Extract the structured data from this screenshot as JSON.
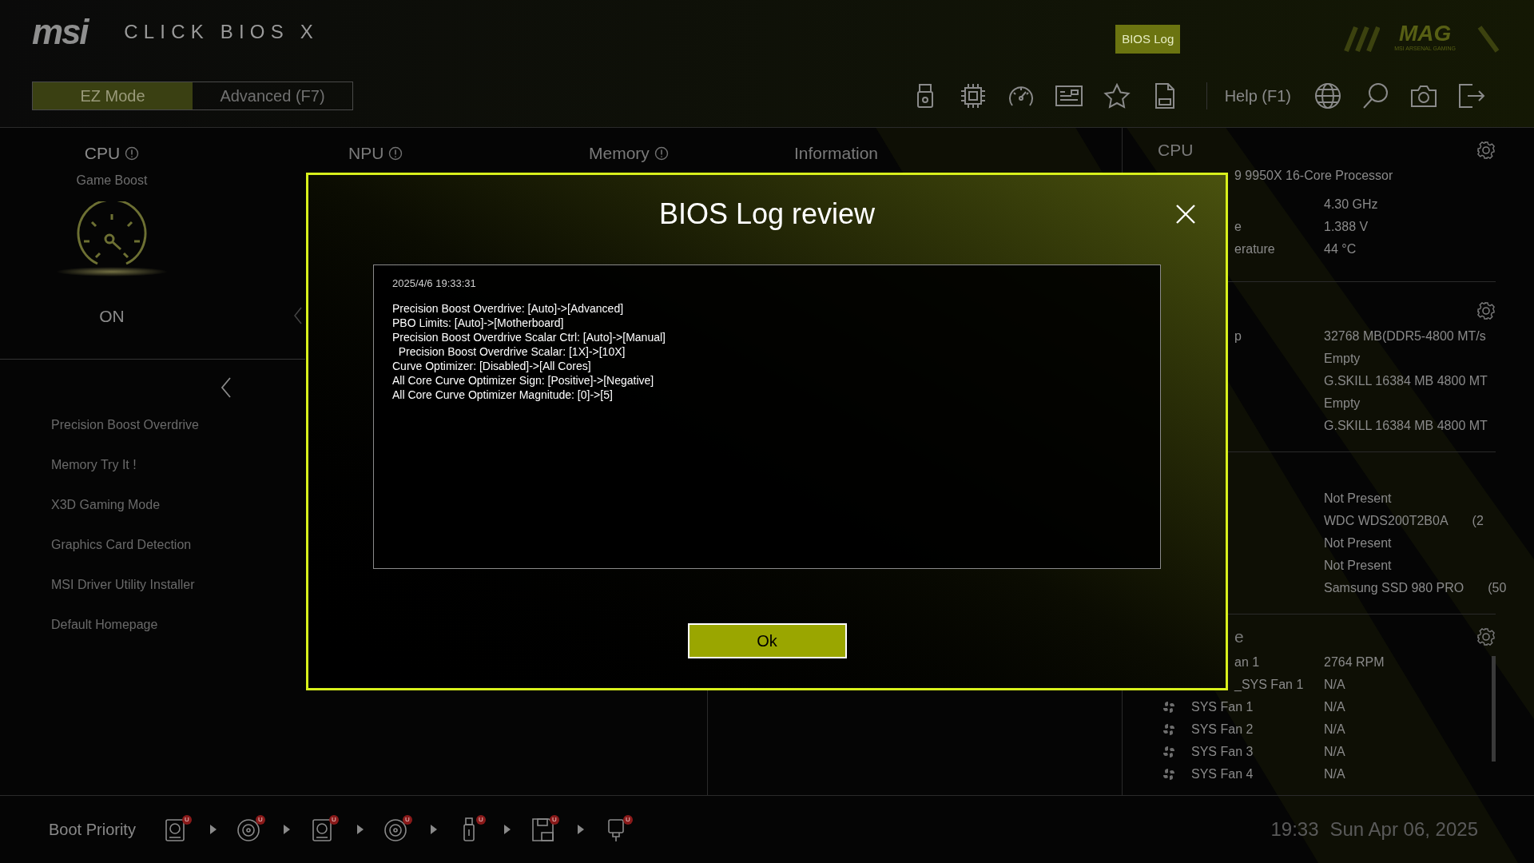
{
  "header": {
    "brand": "msi",
    "product": "CLICK BIOS X",
    "bios_log_tag": "BIOS Log",
    "gaming_logo": {
      "title": "MAG",
      "subtitle": "MSI ARSENAL GAMING"
    },
    "modes": [
      {
        "label": "EZ Mode",
        "selected": true
      },
      {
        "label": "Advanced (F7)",
        "selected": false
      }
    ],
    "help": "Help (F1)"
  },
  "game_boost": {
    "title": "CPU",
    "subtitle": "Game Boost",
    "state": "ON"
  },
  "columns": [
    {
      "title": "NPU",
      "info": true
    },
    {
      "title": "Memory",
      "info": true
    },
    {
      "title": "Information",
      "info": false
    }
  ],
  "menu": [
    "Precision Boost Overdrive",
    "Memory Try It !",
    "X3D Gaming Mode",
    "Graphics Card Detection",
    "MSI Driver Utility Installer",
    "Default Homepage"
  ],
  "right_panel": {
    "cpu": {
      "title": "CPU",
      "processor": "9 9950X 16-Core Processor",
      "rows": [
        {
          "label": "",
          "value": "4.30 GHz"
        },
        {
          "label": "e",
          "value": "1.388 V"
        },
        {
          "label": "erature",
          "value": "44 °C"
        }
      ]
    },
    "memory": {
      "rows": [
        {
          "label": "p",
          "value": "32768 MB(DDR5-4800 MT/s"
        },
        {
          "label": "",
          "value": "Empty"
        },
        {
          "label": "",
          "value": "G.SKILL 16384 MB 4800 MT"
        },
        {
          "label": "",
          "value": "Empty"
        },
        {
          "label": "",
          "value": "G.SKILL 16384 MB 4800 MT"
        }
      ]
    },
    "storage": {
      "rows": [
        {
          "value": "Not Present",
          "size": ""
        },
        {
          "value": "WDC WDS200T2B0A",
          "size": "(2"
        },
        {
          "value": "Not Present",
          "size": ""
        },
        {
          "value": "Not Present",
          "size": ""
        },
        {
          "value": "Samsung SSD 980 PRO",
          "size": "(50"
        }
      ]
    },
    "fans": {
      "title": "e",
      "rows": [
        {
          "label": "an 1",
          "value": "2764 RPM",
          "occluded": true
        },
        {
          "label": "_SYS Fan 1",
          "value": "N/A",
          "occluded": true
        },
        {
          "label": "SYS Fan 1",
          "value": "N/A",
          "occluded": false
        },
        {
          "label": "SYS Fan 2",
          "value": "N/A",
          "occluded": false
        },
        {
          "label": "SYS Fan 3",
          "value": "N/A",
          "occluded": false
        },
        {
          "label": "SYS Fan 4",
          "value": "N/A",
          "occluded": false
        }
      ]
    }
  },
  "boot_priority": {
    "label": "Boot Priority",
    "devices": [
      {
        "kind": "hdd",
        "badge": "U"
      },
      {
        "kind": "disc",
        "badge": "U"
      },
      {
        "kind": "hdd",
        "badge": "U"
      },
      {
        "kind": "disc",
        "badge": "U"
      },
      {
        "kind": "usb",
        "badge": "U"
      },
      {
        "kind": "floppy",
        "badge": "U"
      },
      {
        "kind": "plug",
        "badge": "U"
      }
    ]
  },
  "clock": {
    "time": "19:33",
    "date": "Sun Apr 06, 2025"
  },
  "dialog": {
    "title": "BIOS Log review",
    "timestamp": "2025/4/6 19:33:31",
    "lines": [
      "Precision Boost Overdrive: [Auto]->[Advanced]",
      "PBO Limits: [Auto]->[Motherboard]",
      "Precision Boost Overdrive Scalar Ctrl: [Auto]->[Manual]",
      "  Precision Boost Overdrive Scalar: [1X]->[10X]",
      "Curve Optimizer: [Disabled]->[All Cores]",
      "All Core Curve Optimizer Sign: [Positive]->[Negative]",
      "All Core Curve Optimizer Magnitude: [0]->[5]"
    ],
    "ok": "Ok"
  }
}
